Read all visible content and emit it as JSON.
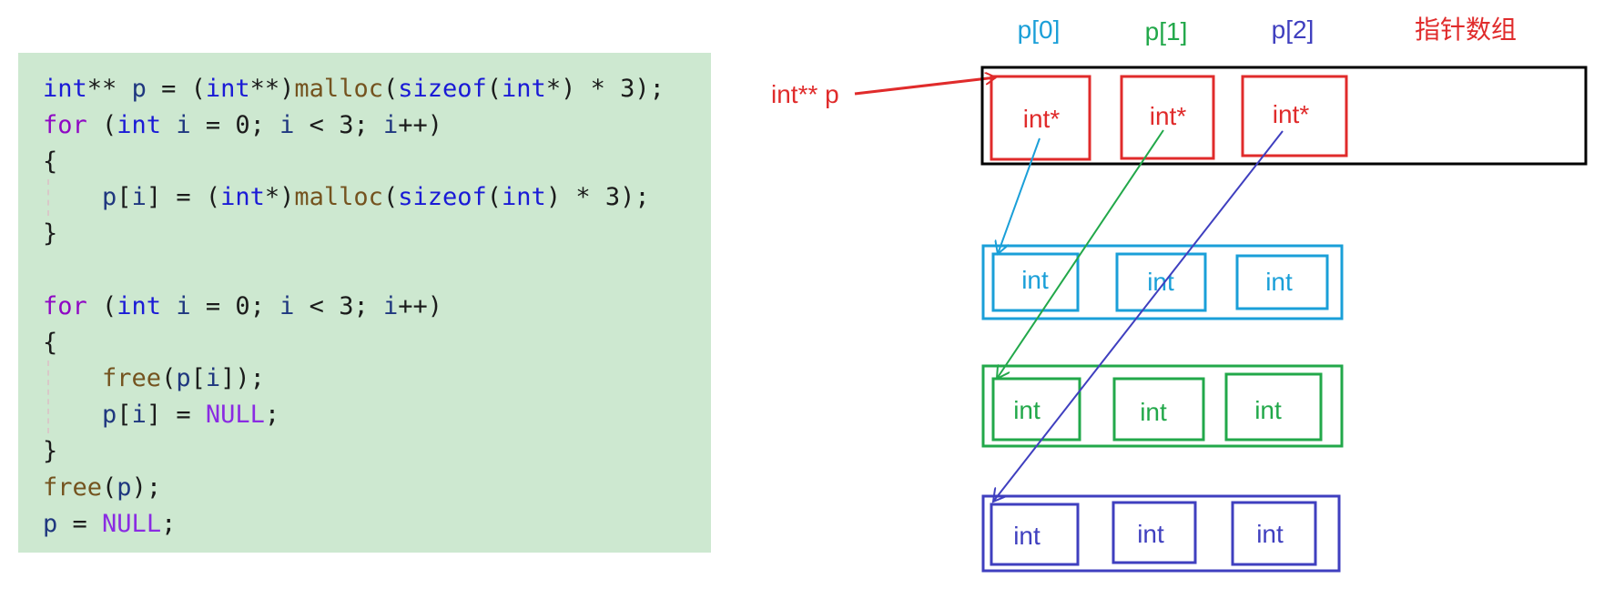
{
  "code": {
    "lines": [
      [
        [
          "kw",
          "int"
        ],
        [
          "",
          "** "
        ],
        [
          "var",
          "p"
        ],
        [
          "",
          " = ("
        ],
        [
          "kw",
          "int"
        ],
        [
          "",
          "**)"
        ],
        [
          "fn",
          "malloc"
        ],
        [
          "",
          "("
        ],
        [
          "kw",
          "sizeof"
        ],
        [
          "",
          "("
        ],
        [
          "kw",
          "int"
        ],
        [
          "",
          "*) * 3);"
        ]
      ],
      [
        [
          "ctl",
          "for"
        ],
        [
          "",
          " ("
        ],
        [
          "kw",
          "int"
        ],
        [
          "",
          " "
        ],
        [
          "var",
          "i"
        ],
        [
          "",
          " = 0; "
        ],
        [
          "var",
          "i"
        ],
        [
          "",
          " < 3; "
        ],
        [
          "var",
          "i"
        ],
        [
          "",
          "++)"
        ]
      ],
      [
        [
          "",
          "{"
        ]
      ],
      [
        [
          "",
          "    "
        ],
        [
          "var",
          "p"
        ],
        [
          "",
          "["
        ],
        [
          "var",
          "i"
        ],
        [
          "",
          "] = ("
        ],
        [
          "kw",
          "int"
        ],
        [
          "",
          "*)"
        ],
        [
          "fn",
          "malloc"
        ],
        [
          "",
          "("
        ],
        [
          "kw",
          "sizeof"
        ],
        [
          "",
          "("
        ],
        [
          "kw",
          "int"
        ],
        [
          "",
          ") * 3);"
        ]
      ],
      [
        [
          "",
          "}"
        ]
      ],
      [],
      [
        [
          "ctl",
          "for"
        ],
        [
          "",
          " ("
        ],
        [
          "kw",
          "int"
        ],
        [
          "",
          " "
        ],
        [
          "var",
          "i"
        ],
        [
          "",
          " = 0; "
        ],
        [
          "var",
          "i"
        ],
        [
          "",
          " < 3; "
        ],
        [
          "var",
          "i"
        ],
        [
          "",
          "++)"
        ]
      ],
      [
        [
          "",
          "{"
        ]
      ],
      [
        [
          "",
          "    "
        ],
        [
          "fn",
          "free"
        ],
        [
          "",
          "("
        ],
        [
          "var",
          "p"
        ],
        [
          "",
          "["
        ],
        [
          "var",
          "i"
        ],
        [
          "",
          "]);"
        ]
      ],
      [
        [
          "",
          "    "
        ],
        [
          "var",
          "p"
        ],
        [
          "",
          "["
        ],
        [
          "var",
          "i"
        ],
        [
          "",
          "] = "
        ],
        [
          "mac",
          "NULL"
        ],
        [
          "",
          ";"
        ]
      ],
      [
        [
          "",
          "}"
        ]
      ],
      [
        [
          "fn",
          "free"
        ],
        [
          "",
          "("
        ],
        [
          "var",
          "p"
        ],
        [
          "",
          ");"
        ]
      ],
      [
        [
          "var",
          "p"
        ],
        [
          "",
          " = "
        ],
        [
          "mac",
          "NULL"
        ],
        [
          "",
          ";"
        ]
      ]
    ]
  },
  "diagram": {
    "title": "指针数组",
    "pointer_label": "int** p",
    "index_labels": [
      "p[0]",
      "p[1]",
      "p[2]"
    ],
    "pointer_cell_label": "int*",
    "int_cell_label": "int",
    "colors": {
      "red": "#e02b2b",
      "black": "#000000",
      "cyan": "#1a9fd8",
      "green": "#22a84a",
      "blue": "#3f3fbf"
    }
  }
}
